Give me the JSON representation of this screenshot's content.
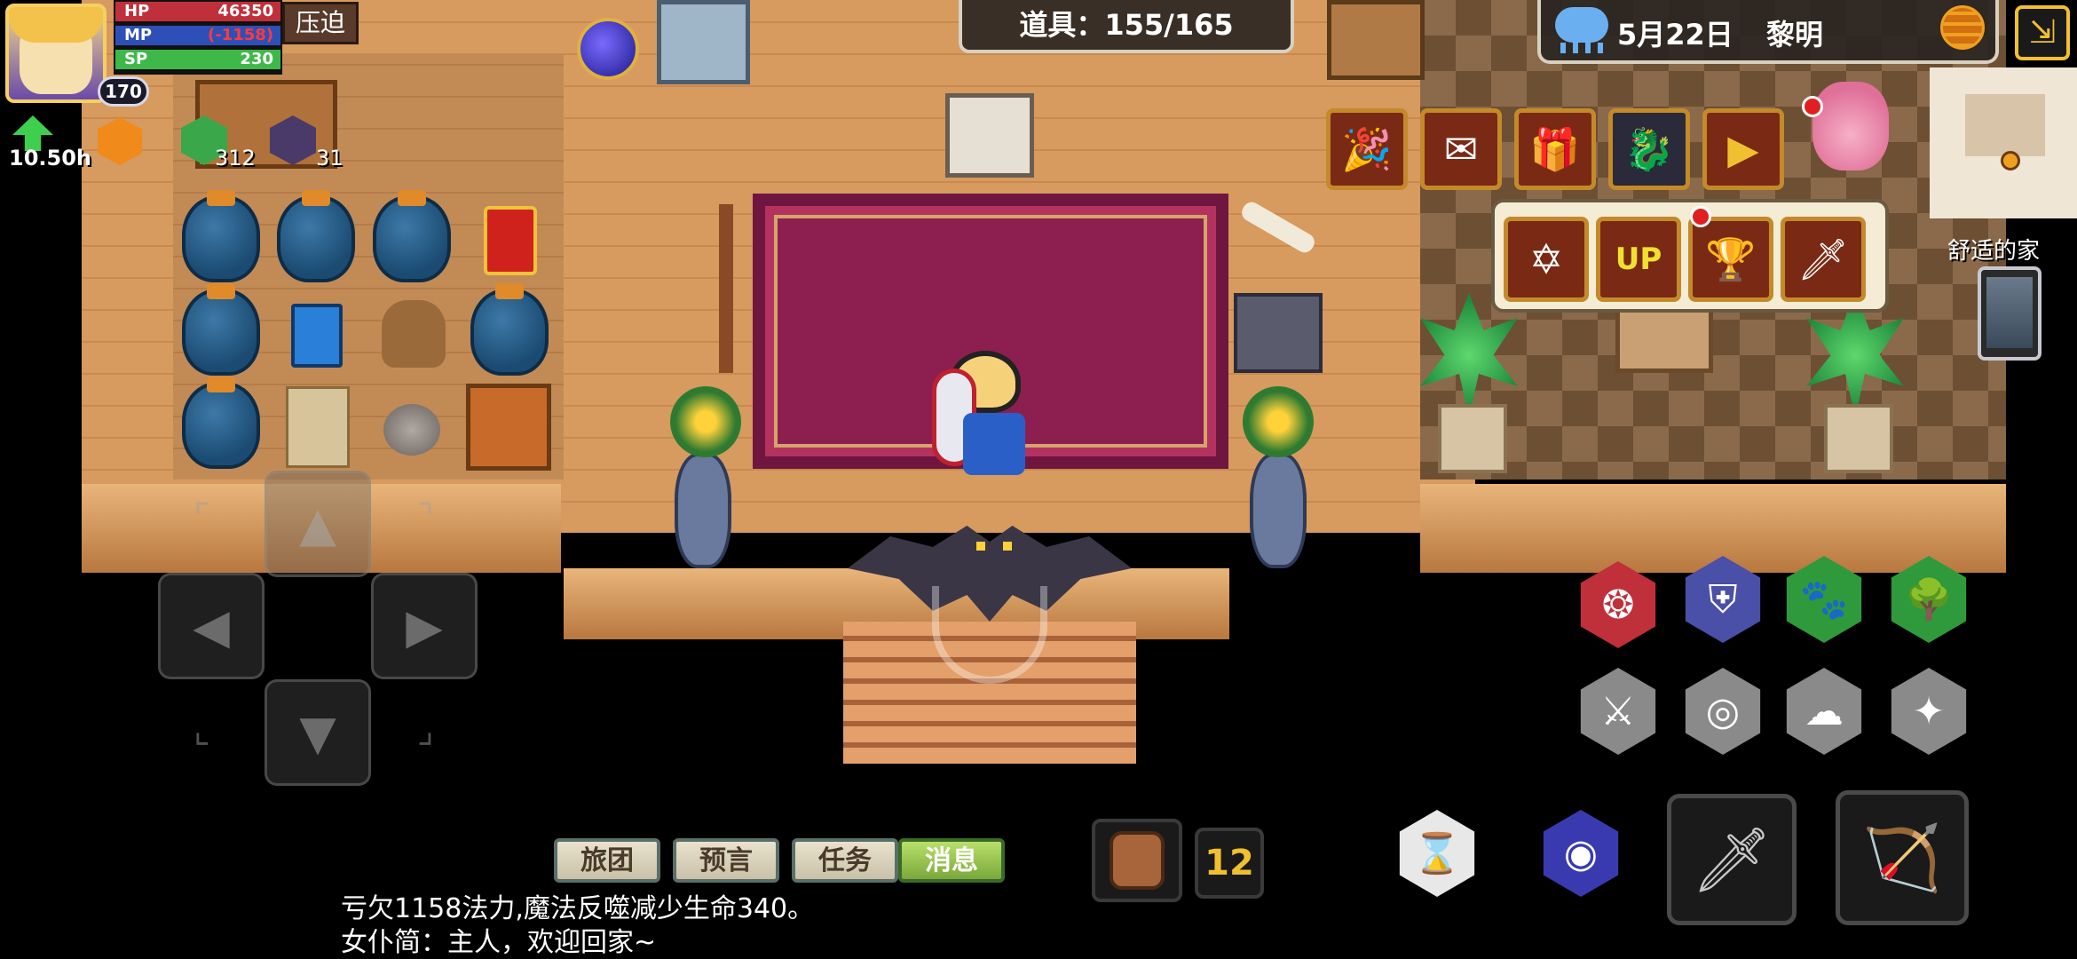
{
  "player": {
    "hp_label": "HP",
    "hp_value": "46350",
    "mp_label": "MP",
    "mp_value": "(-1158)",
    "sp_label": "SP",
    "sp_value": "230",
    "level": "170",
    "status_label": "压迫"
  },
  "buffs": [
    {
      "icon": "growth-arrow-icon",
      "value": "10.50h"
    },
    {
      "icon": "orange-hex-emblem-icon",
      "value": ""
    },
    {
      "icon": "green-tree-badge-icon",
      "value": "312"
    },
    {
      "icon": "ninja-mask-icon",
      "value": "31"
    }
  ],
  "inventory": {
    "label": "道具：155/165"
  },
  "weather": {
    "icon": "rain-cloud-icon",
    "date": "5月22日",
    "time_of_day": "黎明"
  },
  "minimap": {
    "location_name": "舒适的家"
  },
  "top_icons": [
    {
      "name": "party-popper-icon"
    },
    {
      "name": "mail-gift-icon"
    },
    {
      "name": "gift-box-icon"
    },
    {
      "name": "dragon-head-icon"
    },
    {
      "name": "play-video-icon"
    }
  ],
  "popup_icons": [
    {
      "name": "magic-circle-icon"
    },
    {
      "name": "level-up-icon",
      "text": "UP"
    },
    {
      "name": "trophy-icon"
    },
    {
      "name": "sword-shield-icon"
    }
  ],
  "skills": [
    {
      "name": "vortex-skill-icon",
      "color": "#c0303a"
    },
    {
      "name": "shield-skill-icon",
      "color": "#4a4fa8"
    },
    {
      "name": "paw-skill-icon",
      "color": "#2f9a3c"
    },
    {
      "name": "tree-skill-icon",
      "color": "#2f9a3c"
    },
    {
      "name": "slash-skill-icon",
      "color": "#8a8a8a"
    },
    {
      "name": "whirlwind-skill-icon",
      "color": "#8a8a8a"
    },
    {
      "name": "smoke-skill-icon",
      "color": "#8a8a8a"
    },
    {
      "name": "spike-skill-icon",
      "color": "#8a8a8a"
    }
  ],
  "bottom_tabs": [
    "旅团",
    "预言",
    "任务",
    "消息"
  ],
  "hotbar": {
    "page": "12"
  },
  "messages": [
    "亏欠1158法力,魔法反噬减少生命340。",
    "女仆简：主人，欢迎回家~"
  ],
  "colors": {
    "hp_bar": "#c0303a",
    "mp_bar": "#2f4fb8",
    "sp_bar": "#3fb84a",
    "gold_frame": "#c48a2a",
    "message_tab_active": "#8ab84a"
  }
}
